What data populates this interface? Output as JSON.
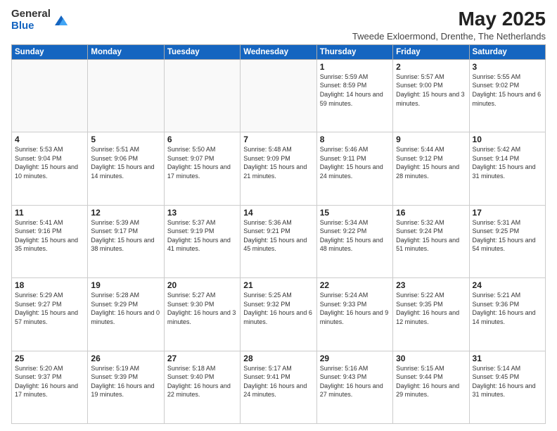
{
  "logo": {
    "general": "General",
    "blue": "Blue"
  },
  "title": "May 2025",
  "subtitle": "Tweede Exloermond, Drenthe, The Netherlands",
  "weekdays": [
    "Sunday",
    "Monday",
    "Tuesday",
    "Wednesday",
    "Thursday",
    "Friday",
    "Saturday"
  ],
  "weeks": [
    [
      {
        "day": "",
        "info": ""
      },
      {
        "day": "",
        "info": ""
      },
      {
        "day": "",
        "info": ""
      },
      {
        "day": "",
        "info": ""
      },
      {
        "day": "1",
        "info": "Sunrise: 5:59 AM\nSunset: 8:59 PM\nDaylight: 14 hours and 59 minutes."
      },
      {
        "day": "2",
        "info": "Sunrise: 5:57 AM\nSunset: 9:00 PM\nDaylight: 15 hours and 3 minutes."
      },
      {
        "day": "3",
        "info": "Sunrise: 5:55 AM\nSunset: 9:02 PM\nDaylight: 15 hours and 6 minutes."
      }
    ],
    [
      {
        "day": "4",
        "info": "Sunrise: 5:53 AM\nSunset: 9:04 PM\nDaylight: 15 hours and 10 minutes."
      },
      {
        "day": "5",
        "info": "Sunrise: 5:51 AM\nSunset: 9:06 PM\nDaylight: 15 hours and 14 minutes."
      },
      {
        "day": "6",
        "info": "Sunrise: 5:50 AM\nSunset: 9:07 PM\nDaylight: 15 hours and 17 minutes."
      },
      {
        "day": "7",
        "info": "Sunrise: 5:48 AM\nSunset: 9:09 PM\nDaylight: 15 hours and 21 minutes."
      },
      {
        "day": "8",
        "info": "Sunrise: 5:46 AM\nSunset: 9:11 PM\nDaylight: 15 hours and 24 minutes."
      },
      {
        "day": "9",
        "info": "Sunrise: 5:44 AM\nSunset: 9:12 PM\nDaylight: 15 hours and 28 minutes."
      },
      {
        "day": "10",
        "info": "Sunrise: 5:42 AM\nSunset: 9:14 PM\nDaylight: 15 hours and 31 minutes."
      }
    ],
    [
      {
        "day": "11",
        "info": "Sunrise: 5:41 AM\nSunset: 9:16 PM\nDaylight: 15 hours and 35 minutes."
      },
      {
        "day": "12",
        "info": "Sunrise: 5:39 AM\nSunset: 9:17 PM\nDaylight: 15 hours and 38 minutes."
      },
      {
        "day": "13",
        "info": "Sunrise: 5:37 AM\nSunset: 9:19 PM\nDaylight: 15 hours and 41 minutes."
      },
      {
        "day": "14",
        "info": "Sunrise: 5:36 AM\nSunset: 9:21 PM\nDaylight: 15 hours and 45 minutes."
      },
      {
        "day": "15",
        "info": "Sunrise: 5:34 AM\nSunset: 9:22 PM\nDaylight: 15 hours and 48 minutes."
      },
      {
        "day": "16",
        "info": "Sunrise: 5:32 AM\nSunset: 9:24 PM\nDaylight: 15 hours and 51 minutes."
      },
      {
        "day": "17",
        "info": "Sunrise: 5:31 AM\nSunset: 9:25 PM\nDaylight: 15 hours and 54 minutes."
      }
    ],
    [
      {
        "day": "18",
        "info": "Sunrise: 5:29 AM\nSunset: 9:27 PM\nDaylight: 15 hours and 57 minutes."
      },
      {
        "day": "19",
        "info": "Sunrise: 5:28 AM\nSunset: 9:29 PM\nDaylight: 16 hours and 0 minutes."
      },
      {
        "day": "20",
        "info": "Sunrise: 5:27 AM\nSunset: 9:30 PM\nDaylight: 16 hours and 3 minutes."
      },
      {
        "day": "21",
        "info": "Sunrise: 5:25 AM\nSunset: 9:32 PM\nDaylight: 16 hours and 6 minutes."
      },
      {
        "day": "22",
        "info": "Sunrise: 5:24 AM\nSunset: 9:33 PM\nDaylight: 16 hours and 9 minutes."
      },
      {
        "day": "23",
        "info": "Sunrise: 5:22 AM\nSunset: 9:35 PM\nDaylight: 16 hours and 12 minutes."
      },
      {
        "day": "24",
        "info": "Sunrise: 5:21 AM\nSunset: 9:36 PM\nDaylight: 16 hours and 14 minutes."
      }
    ],
    [
      {
        "day": "25",
        "info": "Sunrise: 5:20 AM\nSunset: 9:37 PM\nDaylight: 16 hours and 17 minutes."
      },
      {
        "day": "26",
        "info": "Sunrise: 5:19 AM\nSunset: 9:39 PM\nDaylight: 16 hours and 19 minutes."
      },
      {
        "day": "27",
        "info": "Sunrise: 5:18 AM\nSunset: 9:40 PM\nDaylight: 16 hours and 22 minutes."
      },
      {
        "day": "28",
        "info": "Sunrise: 5:17 AM\nSunset: 9:41 PM\nDaylight: 16 hours and 24 minutes."
      },
      {
        "day": "29",
        "info": "Sunrise: 5:16 AM\nSunset: 9:43 PM\nDaylight: 16 hours and 27 minutes."
      },
      {
        "day": "30",
        "info": "Sunrise: 5:15 AM\nSunset: 9:44 PM\nDaylight: 16 hours and 29 minutes."
      },
      {
        "day": "31",
        "info": "Sunrise: 5:14 AM\nSunset: 9:45 PM\nDaylight: 16 hours and 31 minutes."
      }
    ]
  ]
}
